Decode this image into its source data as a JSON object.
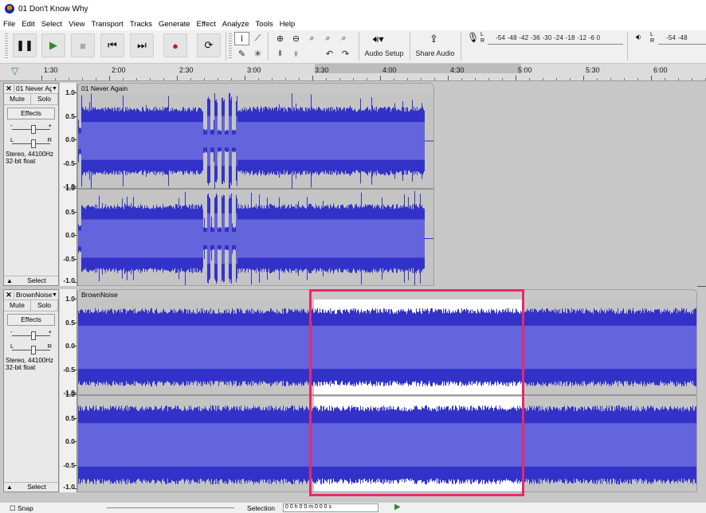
{
  "window": {
    "title": "01 Don't Know Why"
  },
  "menu": [
    "File",
    "Edit",
    "Select",
    "View",
    "Transport",
    "Tracks",
    "Generate",
    "Effect",
    "Analyze",
    "Tools",
    "Help"
  ],
  "toolbar": {
    "transport": [
      {
        "name": "pause-button",
        "glyph": "❚❚",
        "color": "#111111"
      },
      {
        "name": "play-button",
        "glyph": "▶",
        "color": "#2a8f2a"
      },
      {
        "name": "stop-button",
        "glyph": "■",
        "color": "#a8a8a8"
      },
      {
        "name": "skip-start-button",
        "glyph": "⏮",
        "color": "#111111"
      },
      {
        "name": "skip-end-button",
        "glyph": "⏭",
        "color": "#111111"
      },
      {
        "name": "record-button",
        "glyph": "●",
        "color": "#c81e1e"
      },
      {
        "name": "loop-button",
        "glyph": "⟳",
        "color": "#111111"
      }
    ],
    "audio_setup_label": "Audio Setup",
    "share_audio_label": "Share Audio",
    "rec_meter_scale": "-54 -48 -42 -36 -30 -24 -18 -12 -6 0",
    "play_meter_scale": "-54 -48",
    "meter_lr": "L R"
  },
  "timeline": {
    "ticks": [
      "1:30",
      "2:00",
      "2:30",
      "3:00",
      "3:30",
      "4:00",
      "4:30",
      "5:00",
      "5:30",
      "6:00"
    ]
  },
  "tracks": [
    {
      "name": "01 Never Ag",
      "clip_name": "01 Never Again",
      "mute": "Mute",
      "solo": "Solo",
      "effects": "Effects",
      "gain_minus": "-",
      "gain_plus": "+",
      "pan_l": "L",
      "pan_r": "R",
      "info_line1": "Stereo, 44100Hz",
      "info_line2": "32-bit float",
      "select": "Select",
      "collapse": "▲",
      "close": "✕",
      "dropdown": "▼",
      "ruler_top": [
        "1.0",
        "0.5",
        "0.0",
        "-0.5",
        "-1.0"
      ],
      "ruler_bottom": [
        "1.0",
        "0.5",
        "0.0",
        "-0.5",
        "-1.0"
      ],
      "selected": false
    },
    {
      "name": "BrownNoise",
      "clip_name": "BrownNoise",
      "mute": "Mute",
      "solo": "Solo",
      "effects": "Effects",
      "gain_minus": "-",
      "gain_plus": "+",
      "pan_l": "L",
      "pan_r": "R",
      "info_line1": "Stereo, 44100Hz",
      "info_line2": "32-bit float",
      "select": "Select",
      "collapse": "▲",
      "close": "✕",
      "dropdown": "▼",
      "ruler_top": [
        "1.0",
        "0.5",
        "0.0",
        "-0.5",
        "-1.0"
      ],
      "ruler_bottom": [
        "1.0",
        "0.5",
        "0.0",
        "-0.5",
        "-1.0"
      ],
      "selected": true
    }
  ],
  "bottom": {
    "snap_label": "Snap",
    "selection_label": "Selection",
    "selection_value": "0 0 h 0 0 m 0 0 0 s"
  },
  "colors": {
    "waveform_dark": "#3232c8",
    "waveform_light": "#6464dc",
    "selection_highlight": "#e8286a",
    "selected_bg": "#ffffff"
  }
}
